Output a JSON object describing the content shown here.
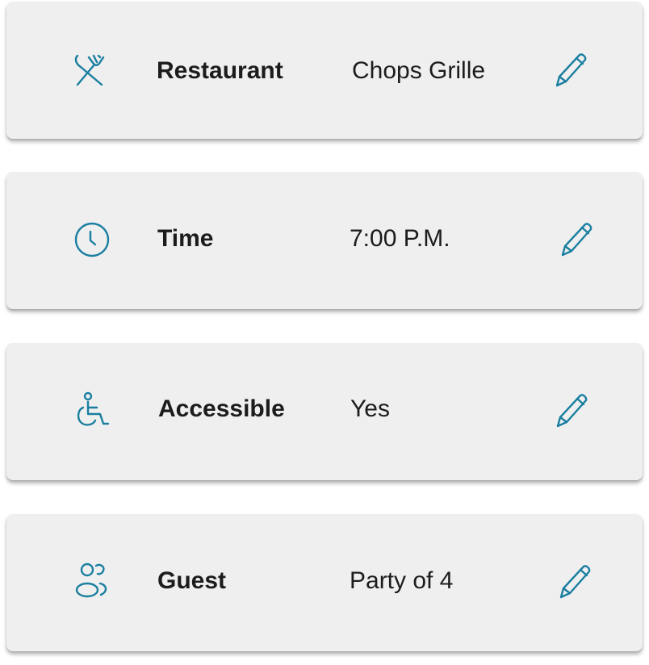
{
  "accent_color": "#1a7fa0",
  "cards": [
    {
      "icon": "fork-knife-icon",
      "label": "Restaurant",
      "value": "Chops Grille"
    },
    {
      "icon": "clock-icon",
      "label": "Time",
      "value": "7:00 P.M."
    },
    {
      "icon": "wheelchair-icon",
      "label": "Accessible",
      "value": "Yes"
    },
    {
      "icon": "guests-icon",
      "label": "Guest",
      "value": "Party of 4"
    }
  ],
  "edit_icon": "pencil-icon"
}
